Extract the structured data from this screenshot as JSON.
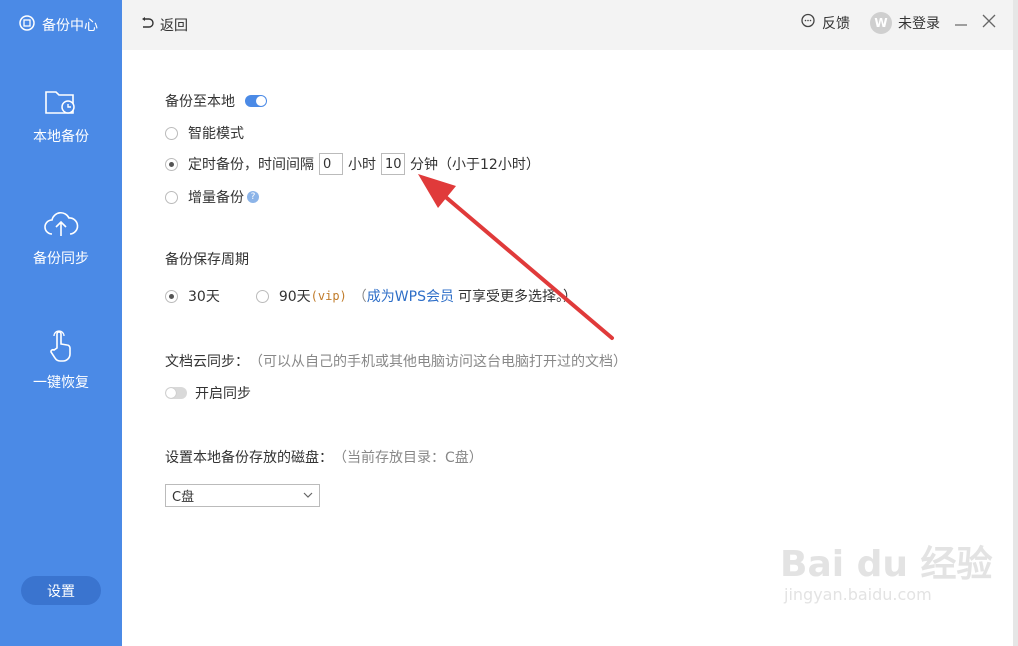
{
  "sidebar": {
    "brand": "备份中心",
    "items": [
      {
        "label": "本地备份",
        "icon": "folder-clock-icon"
      },
      {
        "label": "备份同步",
        "icon": "cloud-upload-icon"
      },
      {
        "label": "一键恢复",
        "icon": "hand-pointer-icon"
      }
    ],
    "settings_label": "设置"
  },
  "topbar": {
    "back_label": "返回",
    "feedback_label": "反馈",
    "login_label": "未登录",
    "avatar_letter": "W"
  },
  "local_backup": {
    "title": "备份至本地",
    "smart_mode": "智能模式",
    "timed_prefix": "定时备份，时间间隔",
    "hours_value": "0",
    "hours_unit": "小时",
    "minutes_value": "10",
    "minutes_unit": "分钟（小于12小时）",
    "incremental": "增量备份",
    "help_mark": "?"
  },
  "retention": {
    "title": "备份保存周期",
    "option_30": "30天",
    "option_90": "90天",
    "vip_tag": "(vip)",
    "hint_open": "（",
    "hint_link": "成为WPS会员",
    "hint_rest": "可享受更多选择。）"
  },
  "cloud_sync": {
    "title": "文档云同步：",
    "hint": "（可以从自己的手机或其他电脑访问这台电脑打开过的文档）",
    "toggle_label": "开启同步"
  },
  "disk": {
    "title": "设置本地备份存放的磁盘：",
    "hint": "（当前存放目录：C盘）",
    "selected": "C盘"
  },
  "watermark": {
    "brand": "Bai du 经验",
    "url": "jingyan.baidu.com"
  },
  "colors": {
    "sidebar": "#4b8ae6",
    "accent": "#4b8ae6",
    "arrow": "#e03a3a"
  }
}
